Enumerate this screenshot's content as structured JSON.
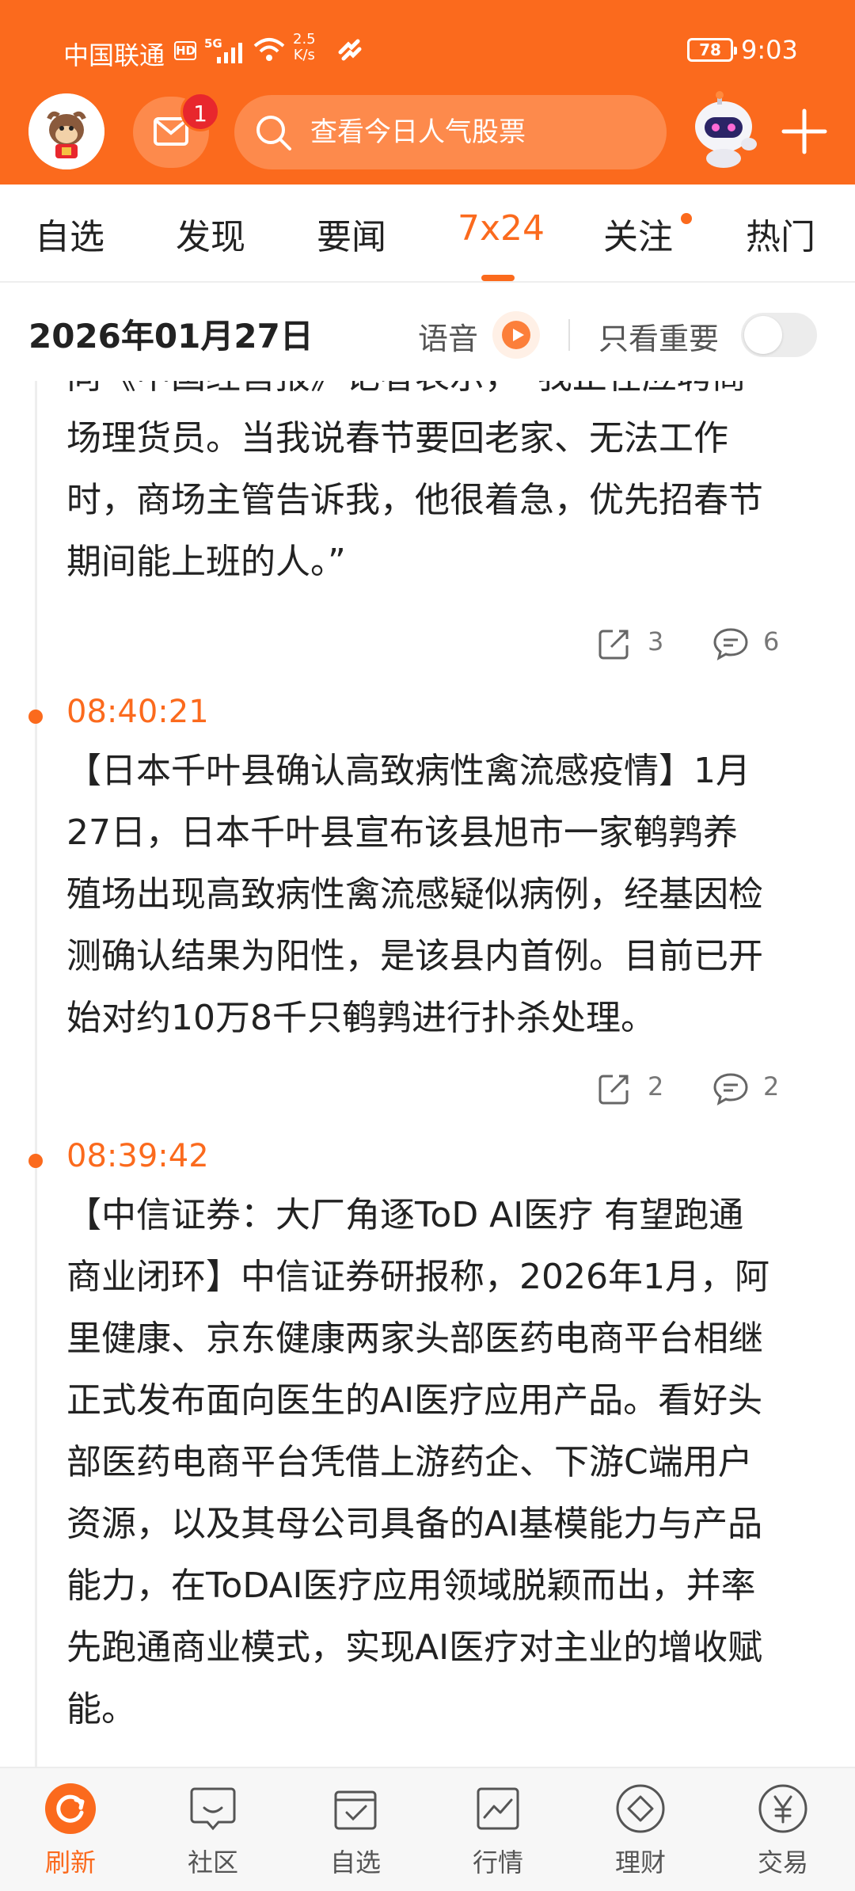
{
  "status_bar": {
    "carrier": "中国联通",
    "hd": "HD",
    "network": "5G",
    "speed_value": "2.5",
    "speed_unit": "K/s",
    "battery": "78",
    "time": "9:03"
  },
  "header": {
    "mail_badge": "1",
    "search_placeholder": "查看今日人气股票"
  },
  "tabs": [
    {
      "label": "自选"
    },
    {
      "label": "发现"
    },
    {
      "label": "要闻"
    },
    {
      "label": "7x24"
    },
    {
      "label": "关注"
    },
    {
      "label": "热门"
    }
  ],
  "active_tab": "7x24",
  "datebar": {
    "date": "2026年01月27日",
    "voice_label": "语音",
    "important_label": "只看重要"
  },
  "feed": {
    "partial_item": {
      "lines": [
        "向《中国经营报》记者表示，“我正在应聘商",
        "场理货员。当我说春节要回老家、无法工作",
        "时，商场主管告诉我，他很着急，优先招春节",
        "期间能上班的人。”"
      ],
      "share_count": "3",
      "comment_count": "6"
    },
    "items": [
      {
        "time": "08:40:21",
        "lines": [
          "【日本千叶县确认高致病性禽流感疫情】1月",
          "27日，日本千叶县宣布该县旭市一家鹌鹑养",
          "殖场出现高致病性禽流感疑似病例，经基因检",
          "测确认结果为阳性，是该县内首例。目前已开",
          "始对约10万8千只鹌鹑进行扑杀处理。"
        ],
        "share_count": "2",
        "comment_count": "2"
      },
      {
        "time": "08:39:42",
        "lines": [
          "【中信证券：大厂角逐ToD AI医疗 有望跑通",
          "商业闭环】中信证券研报称，2026年1月，阿",
          "里健康、京东健康两家头部医药电商平台相继",
          "正式发布面向医生的AI医疗应用产品。看好头",
          "部医药电商平台凭借上游药企、下游C端用户",
          "资源，以及其母公司具备的AI基模能力与产品",
          "能力，在ToDAI医疗应用领域脱颖而出，并率",
          "先跑通商业模式，实现AI医疗对主业的增收赋",
          "能。"
        ]
      }
    ]
  },
  "bottom_nav": [
    {
      "label": "刷新",
      "icon": "refresh-icon"
    },
    {
      "label": "社区",
      "icon": "chat-bubble-icon"
    },
    {
      "label": "自选",
      "icon": "checklist-icon"
    },
    {
      "label": "行情",
      "icon": "chart-icon"
    },
    {
      "label": "理财",
      "icon": "diamond-icon"
    },
    {
      "label": "交易",
      "icon": "yen-icon"
    }
  ],
  "colors": {
    "brand_orange": "#fb6a1d",
    "badge_red": "#e8272d",
    "text_primary": "#222222",
    "text_secondary": "#777777"
  }
}
